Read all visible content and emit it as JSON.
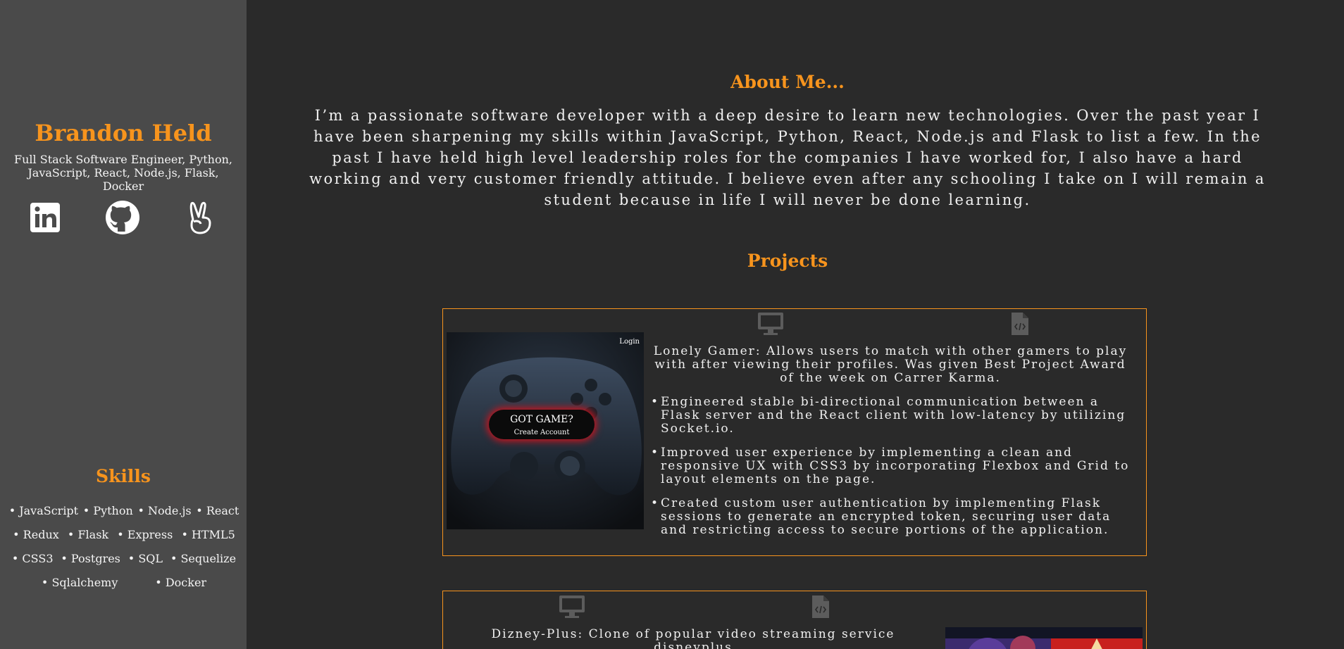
{
  "profile": {
    "name": "Brandon Held",
    "subtitle": "Full Stack Software Engineer, Python, JavaScript, React, Node.js, Flask, Docker",
    "social": [
      "linkedin-icon",
      "github-icon",
      "angellist-icon"
    ]
  },
  "skills": {
    "title": "Skills",
    "rows": [
      [
        "• JavaScript",
        "• Python",
        "• Node.js",
        "• React"
      ],
      [
        "• Redux",
        "• Flask",
        "• Express",
        "• HTML5"
      ],
      [
        "• CSS3",
        "• Postgres",
        "• SQL",
        "• Sequelize"
      ],
      [
        "• Sqlalchemy",
        "• Docker"
      ]
    ]
  },
  "about": {
    "title": "About Me...",
    "text": "I’m a passionate software developer with a deep desire to learn new technologies. Over the past year I have been sharpening my skills within JavaScript, Python, React, Node.js and Flask to list a few. In the past I have held high level leadership roles for the companies I have worked for, I also have a hard working and very customer friendly attitude. I believe even after any schooling I take on I will remain a student because in life I will never be done learning."
  },
  "projects": {
    "title": "Projects",
    "items": [
      {
        "description": "Lonely Gamer: Allows users to match with other gamers to play with after viewing their profiles. Was given Best Project Award of the week on Carrer Karma.",
        "bullets": [
          "Engineered stable bi-directional communication between a Flask server and the React client with low-latency by utilizing Socket.io.",
          "Improved user experience by implementing a clean and responsive UX with CSS3 by incorporating Flexbox and Grid to layout elements on the page.",
          "Created custom user authentication by implementing Flask sessions to generate an encrypted token, securing user data and restricting access to secure portions of the application."
        ],
        "screenshot": {
          "login": "Login",
          "headline": "GOT GAME?",
          "button": "Create Account"
        }
      },
      {
        "description": "Dizney-Plus: Clone of popular video streaming service disneyplus"
      }
    ]
  },
  "colors": {
    "accent": "#f7941d",
    "sidebar": "#4a4a4a",
    "background": "#2a2a2a",
    "icon_muted": "#5c5c5c"
  }
}
